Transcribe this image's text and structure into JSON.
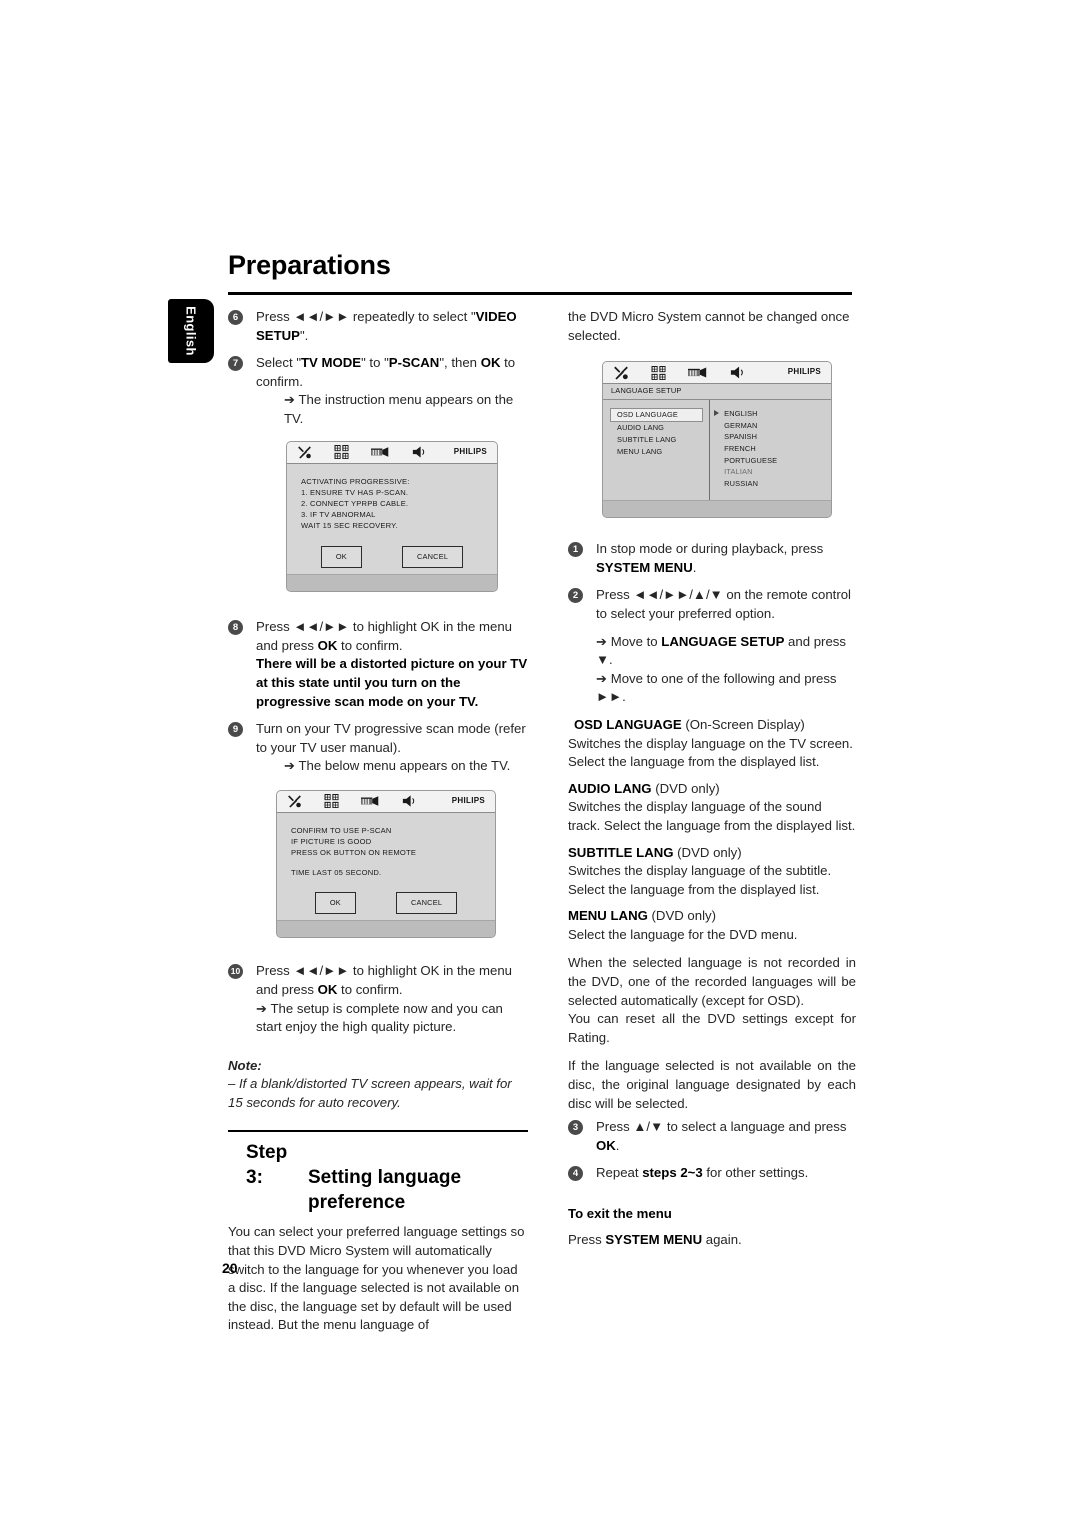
{
  "document": {
    "title": "Preparations",
    "side_tab": "English",
    "page_number": "20"
  },
  "left_column": {
    "step6": {
      "number": "6",
      "text_before": "Press ",
      "keys": "◄◄/►►",
      "text_mid": " repeatedly to select \"",
      "bold": "VIDEO SETUP",
      "text_after": "\"."
    },
    "step7": {
      "number": "7",
      "t1": "Select \"",
      "b1": "TV MODE",
      "t2": "\" to \"",
      "b2": "P-SCAN",
      "t3": "\", then ",
      "b3": "OK",
      "t4": " to confirm.",
      "result": "➔ The instruction menu appears on the TV."
    },
    "screenshot1": {
      "name": "ACTIVATING PROGRESSIVE menu",
      "brand": "PHILIPS",
      "lines": [
        "ACTIVATING PROGRESSIVE:",
        "1. ENSURE TV HAS P-SCAN.",
        "2. CONNECT YPRPB CABLE.",
        "3. IF TV ABNORMAL",
        "WAIT 15 SEC RECOVERY."
      ],
      "ok_label": "OK",
      "cancel_label": "CANCEL"
    },
    "step8": {
      "number": "8",
      "t1": "Press ",
      "keys": "◄◄/►►",
      "t2": " to highlight OK in the menu and press ",
      "b1": "OK",
      "t3": " to confirm.",
      "bold_block": "There will be a distorted picture on your TV at this state until you turn on the progressive scan mode on your TV."
    },
    "step9": {
      "number": "9",
      "text": "Turn on your TV progressive scan mode (refer to your TV user manual).",
      "result": "➔ The below menu appears on the TV."
    },
    "screenshot2": {
      "name": "CONFIRM TO USE P-SCAN menu",
      "brand": "PHILIPS",
      "lines": [
        "CONFIRM TO USE P-SCAN",
        "IF PICTURE IS GOOD",
        "PRESS OK BUTTON ON REMOTE"
      ],
      "lines2": [
        "TIME LAST 05 SECOND."
      ],
      "ok_label": "OK",
      "cancel_label": "CANCEL"
    },
    "step10": {
      "number": "10",
      "t1": "Press ",
      "keys": "◄◄/►►",
      "t2": " to highlight OK in the menu and press ",
      "b1": "OK",
      "t3": " to confirm.",
      "result": "➔ The setup is complete now and you can start enjoy the high quality picture."
    },
    "note": {
      "title": "Note:",
      "text": "–  If a blank/distorted TV screen appears, wait for 15 seconds for auto recovery."
    },
    "step3_heading": {
      "label": "Step 3:",
      "line1": "Setting language",
      "line2": "preference"
    },
    "step3_body": "You can select your preferred language settings so that this DVD Micro System will automatically switch to the language for you whenever you load a disc. If the language selected is not available on the disc, the language set by default will be used instead. But the menu language of"
  },
  "right_column": {
    "continuation": "the DVD Micro System cannot be changed once selected.",
    "screenshot3": {
      "name": "LANGUAGE SETUP menu",
      "brand": "PHILIPS",
      "subbar": "LANGUAGE SETUP",
      "menu_items": [
        "OSD LANGUAGE",
        "AUDIO LANG",
        "SUBTITLE LANG",
        "MENU LANG"
      ],
      "selected_index": 0,
      "options": [
        "ENGLISH",
        "GERMAN",
        "SPANISH",
        "FRENCH",
        "PORTUGUESE",
        "ITALIAN",
        "RUSSIAN"
      ]
    },
    "step1": {
      "number": "1",
      "t1": "In stop mode or during playback, press ",
      "b1": "SYSTEM MENU",
      "t2": "."
    },
    "step2": {
      "number": "2",
      "t1": "Press ",
      "keys": "◄◄/►►/▲/▼",
      "t2": " on the remote control to select your preferred option.",
      "bullet1_pre": "➔ Move to ",
      "bullet1_bold": "LANGUAGE SETUP",
      "bullet1_post": " and press ▼.",
      "bullet2": "➔ Move to one of the following and press ►►."
    },
    "definitions": [
      {
        "term": "OSD LANGUAGE",
        "qualifier": " (On-Screen Display)",
        "body": "Switches the display language on the TV screen. Select the language from the displayed list."
      },
      {
        "term": "AUDIO LANG",
        "qualifier": " (DVD only)",
        "body": "Switches the display language of the sound track. Select the language from the displayed list."
      },
      {
        "term": "SUBTITLE LANG",
        "qualifier": " (DVD only)",
        "body": "Switches the display language of the subtitle. Select the language from the displayed list."
      },
      {
        "term": "MENU LANG",
        "qualifier": " (DVD only)",
        "body": "Select the language for the DVD menu."
      }
    ],
    "para1": " When the selected language is not recorded in the DVD, one of the recorded languages will be selected automatically (except for OSD).",
    "para2": "You can reset all the DVD settings except for Rating.",
    "para3": "If the language selected is not available on the disc, the original language designated by each disc will be selected.",
    "step3": {
      "number": "3",
      "t1": "Press ",
      "keys": "▲/▼",
      "t2": " to select a language and press ",
      "b1": "OK",
      "t3": "."
    },
    "step4": {
      "number": "4",
      "t1": "Repeat ",
      "b1": "steps 2~3",
      "t2": " for other settings."
    },
    "exit": {
      "title": "To exit the menu",
      "t1": "Press ",
      "b1": "SYSTEM MENU",
      "t2": " again."
    }
  }
}
